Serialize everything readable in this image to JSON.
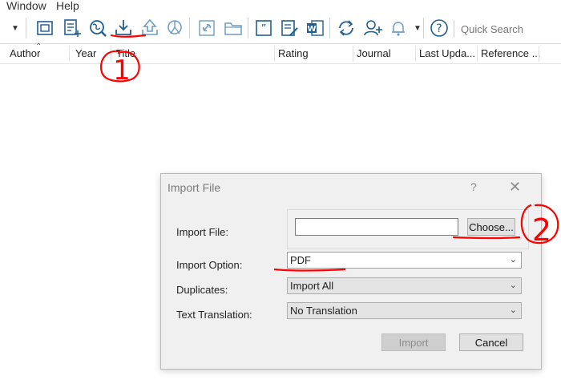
{
  "menu": {
    "window": "Window",
    "help": "Help"
  },
  "toolbar": {
    "icons": [
      "group-icon",
      "new-reference-icon",
      "online-search-icon",
      "import-icon",
      "export-icon",
      "find-full-text-icon",
      "link-icon",
      "folder-icon",
      "cite-icon",
      "edit-output-icon",
      "word-icon",
      "sync-icon",
      "share-user-icon",
      "notification-icon",
      "help-icon"
    ],
    "quick_search_placeholder": "Quick Search"
  },
  "columns": [
    "Author",
    "Year",
    "Title",
    "Rating",
    "Journal",
    "Last Upda...",
    "Reference ..."
  ],
  "annotations": {
    "marker_1": "1",
    "marker_2": "2"
  },
  "dialog": {
    "title": "Import File",
    "help_glyph": "?",
    "import_file_label": "Import File:",
    "import_file_value": "",
    "choose_label": "Choose...",
    "import_option_label": "Import Option:",
    "import_option_value": "PDF",
    "duplicates_label": "Duplicates:",
    "duplicates_value": "Import All",
    "text_translation_label": "Text Translation:",
    "text_translation_value": "No Translation",
    "import_button": "Import",
    "cancel_button": "Cancel"
  },
  "colors": {
    "accent": "#1f5e92",
    "annotation": "#ff0000"
  }
}
